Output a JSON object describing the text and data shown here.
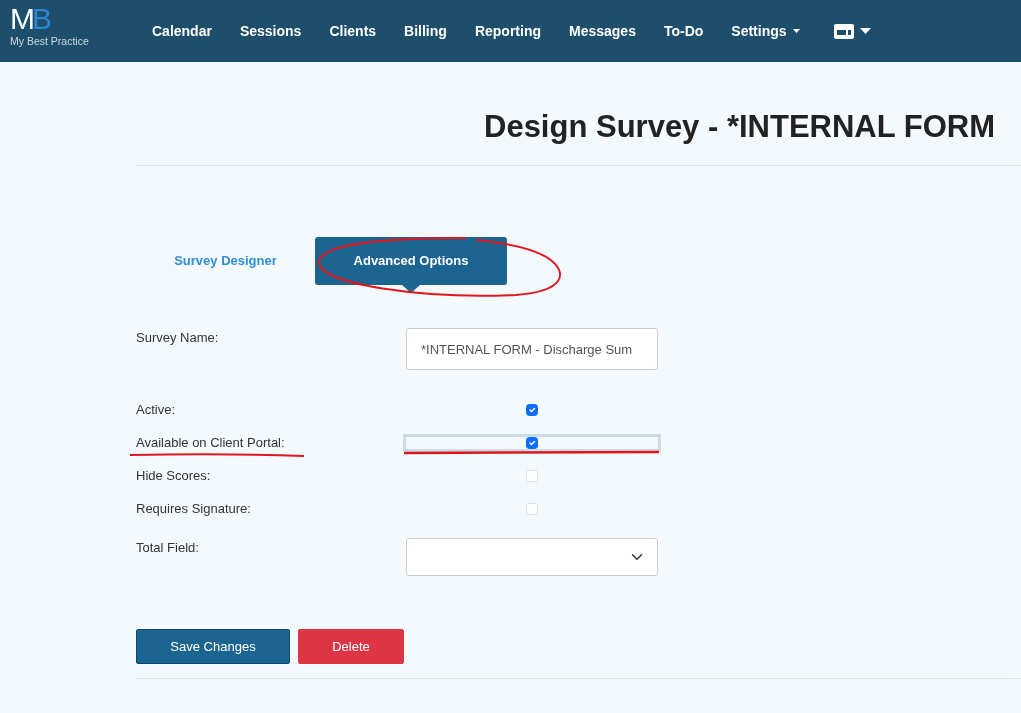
{
  "navbar": {
    "logo": {
      "monogram_left": "M",
      "monogram_right": "B",
      "tagline": "My Best Practice"
    },
    "items": [
      {
        "label": "Calendar",
        "dropdown": false
      },
      {
        "label": "Sessions",
        "dropdown": false
      },
      {
        "label": "Clients",
        "dropdown": false
      },
      {
        "label": "Billing",
        "dropdown": false
      },
      {
        "label": "Reporting",
        "dropdown": false
      },
      {
        "label": "Messages",
        "dropdown": false
      },
      {
        "label": "To-Do",
        "dropdown": false
      },
      {
        "label": "Settings",
        "dropdown": true
      }
    ]
  },
  "page_title": "Design Survey - *INTERNAL FORM",
  "tabs": [
    {
      "label": "Survey Designer",
      "selected": false
    },
    {
      "label": "Advanced Options",
      "selected": true
    }
  ],
  "fields": [
    {
      "kind": "text",
      "label": "Survey Name:",
      "value": "*INTERNAL FORM - Discharge Sum"
    },
    {
      "kind": "checkbox",
      "label": "Active:",
      "checked": true,
      "focused": false
    },
    {
      "kind": "checkbox",
      "label": "Available on Client Portal:",
      "checked": true,
      "focused": true
    },
    {
      "kind": "checkbox",
      "label": "Hide Scores:",
      "checked": false,
      "focused": false
    },
    {
      "kind": "checkbox",
      "label": "Requires Signature:",
      "checked": false,
      "focused": false
    },
    {
      "kind": "select",
      "label": "Total Field:"
    }
  ],
  "buttons": [
    {
      "label": "Save Changes",
      "kind": "primary"
    },
    {
      "label": "Delete",
      "kind": "danger"
    }
  ],
  "annotations": [
    {
      "kind": "ellipse"
    },
    {
      "kind": "underline"
    },
    {
      "kind": "underline"
    }
  ]
}
